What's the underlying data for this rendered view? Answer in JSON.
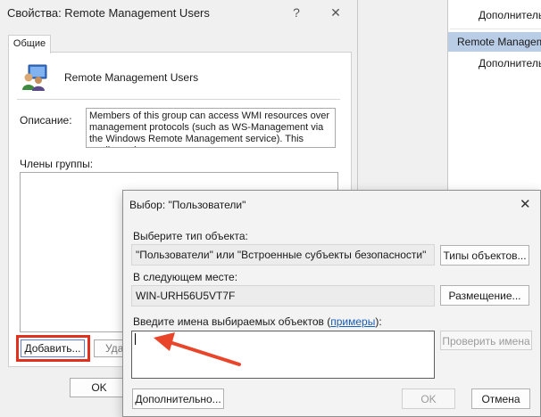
{
  "prop_window": {
    "title": "Свойства: Remote Management Users",
    "help_btn": "?",
    "close_btn": "✕",
    "tab_general": "Общие",
    "group_name": "Remote Management Users",
    "description_label": "Описание:",
    "description_text": "Members of this group can access WMI resources over management protocols (such as WS-Management via the Windows Remote Management service). This applies only",
    "members_label": "Члены группы:",
    "add_button": "Добавить...",
    "remove_button": "Удалить",
    "ok_button": "OK"
  },
  "right_pane": {
    "items": [
      "Дополнитель",
      "Remote Managem",
      "Дополнитель"
    ]
  },
  "select_dialog": {
    "title": "Выбор: \"Пользователи\"",
    "close_btn": "✕",
    "object_type_label": "Выберите тип объекта:",
    "object_type_value": "\"Пользователи\" или \"Встроенные субъекты безопасности\"",
    "object_types_button": "Типы объектов...",
    "location_label": "В следующем месте:",
    "location_value": "WIN-URH56U5VT7F",
    "location_button": "Размещение...",
    "enter_names_label_prefix": "Введите имена выбираемых объектов (",
    "enter_names_link": "примеры",
    "enter_names_label_suffix": "):",
    "names_input_value": "",
    "check_names_button": "Проверить имена",
    "advanced_button": "Дополнительно...",
    "ok_button": "OK",
    "cancel_button": "Отмена"
  },
  "colors": {
    "highlight_box": "#e0301e",
    "arrow": "#e8452b",
    "selected_row": "#b9cde6",
    "link": "#1a5fb4"
  }
}
